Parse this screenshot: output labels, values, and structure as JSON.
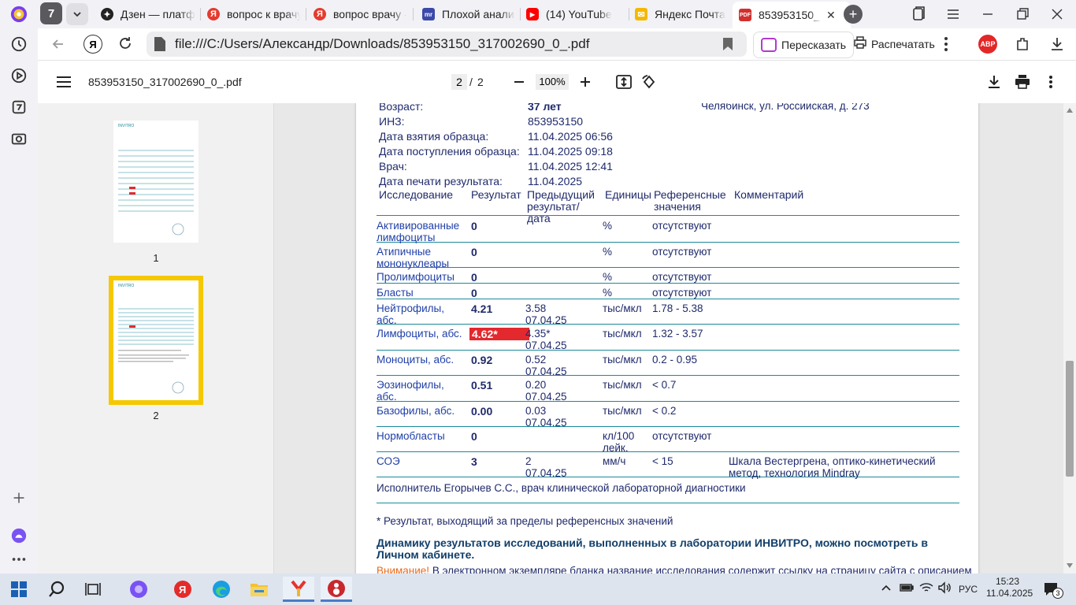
{
  "browser": {
    "tab_count": "7",
    "tabs": [
      {
        "label": "Дзен — платформа",
        "icon": "zen-icon"
      },
      {
        "label": "вопрос к врачу",
        "icon": "yandex-icon"
      },
      {
        "label": "вопрос врачу -",
        "icon": "yandex-icon"
      },
      {
        "label": "Плохой анализ",
        "icon": "mail-icon"
      },
      {
        "label": "(14) YouTube",
        "icon": "youtube-icon"
      },
      {
        "label": "Яндекс Почта",
        "icon": "yandex-mail-icon"
      },
      {
        "label": "853953150_",
        "icon": "pdf-icon"
      }
    ],
    "url": "file:///C:/Users/Александр/Downloads/853953150_317002690_0_.pdf",
    "retell_label": "Пересказать",
    "print_label": "Распечатать",
    "adblock_label": "ABP"
  },
  "pdf": {
    "filename": "853953150_317002690_0_.pdf",
    "current_page": "2",
    "page_separator": "/",
    "total_pages": "2",
    "zoom": "100%",
    "thumbs": [
      {
        "num": "1"
      },
      {
        "num": "2"
      }
    ]
  },
  "document": {
    "age_label": "Возраст:",
    "age_value": "37 лет",
    "address": "Челябинск, ул. Российская, д. 273",
    "info": [
      {
        "label": "ИНЗ:",
        "value": "853953150"
      },
      {
        "label": "Дата взятия образца:",
        "value": "11.04.2025 06:56"
      },
      {
        "label": "Дата поступления образца:",
        "value": "11.04.2025 09:18"
      },
      {
        "label": "Врач:",
        "value": "11.04.2025 12:41"
      },
      {
        "label": "Дата печати результата:",
        "value": "11.04.2025"
      }
    ],
    "headers": {
      "study": "Исследование",
      "result": "Результат",
      "prev": "Предыдущий результат/дата",
      "units": "Единицы",
      "ref": "Референсные значения",
      "comment": "Комментарий"
    },
    "rows": [
      {
        "name": "Активированные лимфоциты",
        "result": "0",
        "prev": "",
        "units": "%",
        "ref": "отсутствуют",
        "comment": ""
      },
      {
        "name": "Атипичные мононуклеары",
        "result": "0",
        "prev": "",
        "units": "%",
        "ref": "отсутствуют",
        "comment": ""
      },
      {
        "name": "Пролимфоциты",
        "result": "0",
        "prev": "",
        "units": "%",
        "ref": "отсутствуют",
        "comment": ""
      },
      {
        "name": "Бласты",
        "result": "0",
        "prev": "",
        "units": "%",
        "ref": "отсутствуют",
        "comment": ""
      },
      {
        "name": "Нейтрофилы, абс.",
        "result": "4.21",
        "prev": "3.58\n07.04.25",
        "units": "тыс/мкл",
        "ref": "1.78 - 5.38",
        "comment": ""
      },
      {
        "name": "Лимфоциты, абс.",
        "result": "4.62*",
        "prev": "4.35*\n07.04.25",
        "units": "тыс/мкл",
        "ref": "1.32 - 3.57",
        "comment": ""
      },
      {
        "name": "Моноциты, абс.",
        "result": "0.92",
        "prev": "0.52\n07.04.25",
        "units": "тыс/мкл",
        "ref": "0.2 - 0.95",
        "comment": ""
      },
      {
        "name": "Эозинофилы, абс.",
        "result": "0.51",
        "prev": "0.20\n07.04.25",
        "units": "тыс/мкл",
        "ref": "< 0.7",
        "comment": ""
      },
      {
        "name": "Базофилы, абс.",
        "result": "0.00",
        "prev": "0.03\n07.04.25",
        "units": "тыс/мкл",
        "ref": "< 0.2",
        "comment": ""
      },
      {
        "name": "Нормобласты",
        "result": "0",
        "prev": "",
        "units": "кл/100\nлейк.",
        "ref": "отсутствуют",
        "comment": ""
      },
      {
        "name": "СОЭ",
        "result": "3",
        "prev": "2\n07.04.25",
        "units": "мм/ч",
        "ref": "< 15",
        "comment": "Шкала Вестергрена, оптико-кинетический метод, технология Mindray"
      }
    ],
    "executor": "Исполнитель Егорычев С.С., врач клинической лабораторной диагностики",
    "footnote": "* Результат, выходящий за пределы референсных значений",
    "dynamics": "Динамику результатов исследований, выполненных в лаборатории ИНВИТРО, можно посмотреть в Личном кабинете.",
    "warning_label": "Внимание!",
    "warning_text": "В электронном экземпляре бланка название исследования содержит ссылку на страницу сайта с описанием"
  },
  "taskbar": {
    "language": "РУС",
    "time": "15:23",
    "date": "11.04.2025",
    "notifications": "3"
  },
  "colors": {
    "flag_red": "#e3282e",
    "thumb_highlight": "#f5c800",
    "table_rule": "#1b8a9a"
  }
}
